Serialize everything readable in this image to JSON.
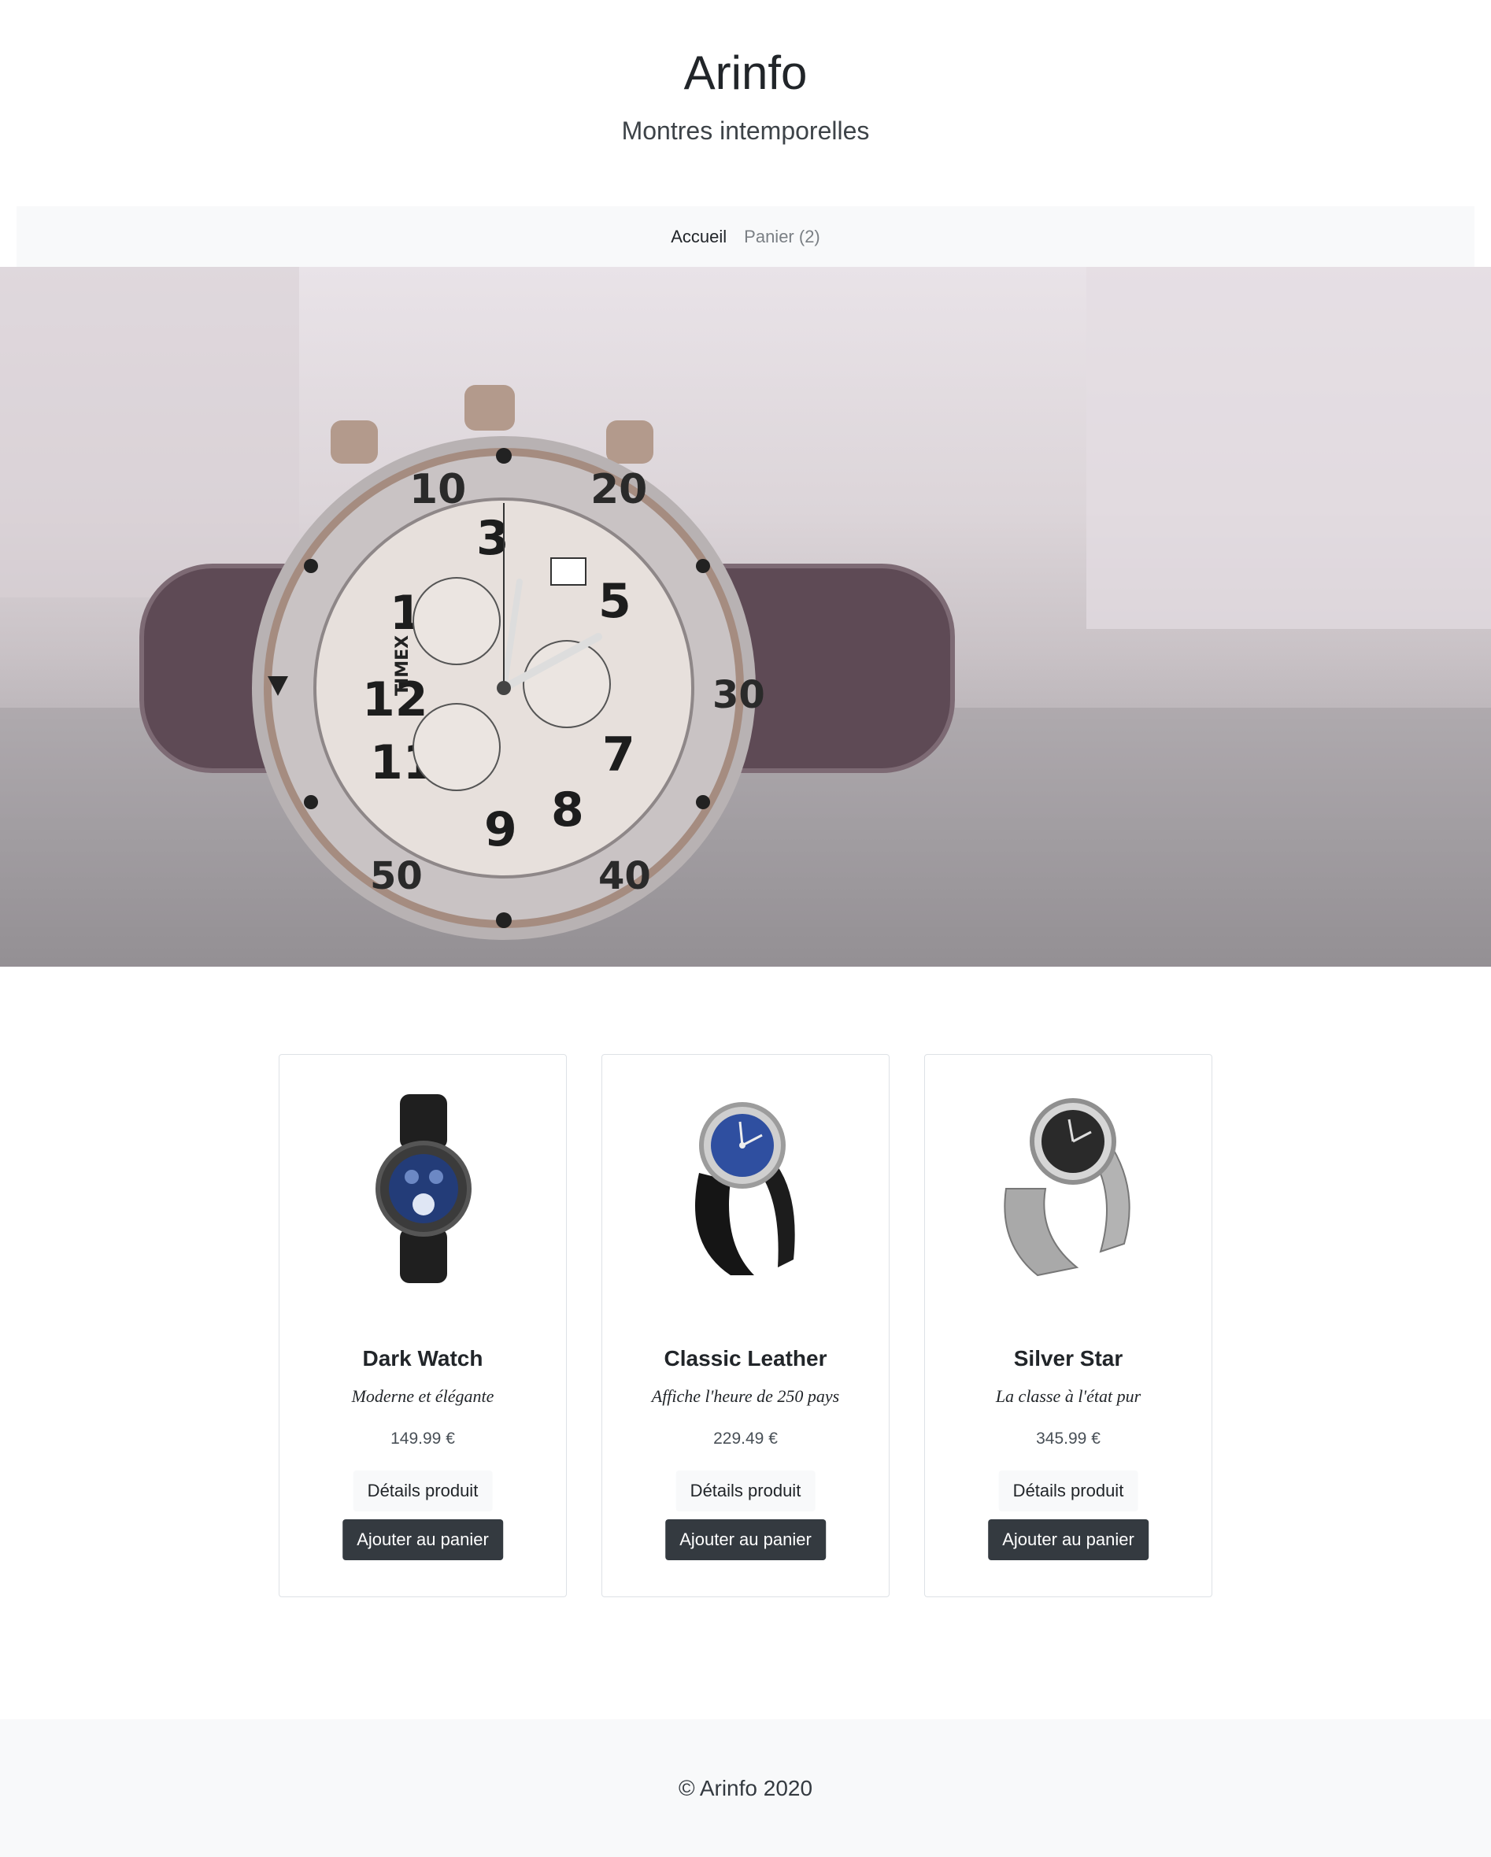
{
  "header": {
    "title": "Arinfo",
    "subtitle": "Montres intemporelles"
  },
  "nav": {
    "home_label": "Accueil",
    "cart_label": "Panier (2)"
  },
  "hero": {
    "image": "chronograph-watch-photo",
    "watch_brand_text": "TIMEX"
  },
  "products": [
    {
      "name": "Dark Watch",
      "description": "Moderne et élégante",
      "price": "149.99 €",
      "details_label": "Détails produit",
      "cart_label": "Ajouter au panier",
      "image": "dark-smartwatch"
    },
    {
      "name": "Classic Leather",
      "description": "Affiche l'heure de 250 pays",
      "price": "229.49 €",
      "details_label": "Détails produit",
      "cart_label": "Ajouter au panier",
      "image": "blue-dial-leather-watch"
    },
    {
      "name": "Silver Star",
      "description": "La classe à l'état pur",
      "price": "345.99 €",
      "details_label": "Détails produit",
      "cart_label": "Ajouter au panier",
      "image": "silver-bracelet-watch"
    }
  ],
  "footer": {
    "copyright": "© Arinfo 2020"
  },
  "colors": {
    "navbar_bg": "#f8f9fa",
    "dark_button": "#343a40",
    "footer_bg": "#f8f9fa"
  }
}
